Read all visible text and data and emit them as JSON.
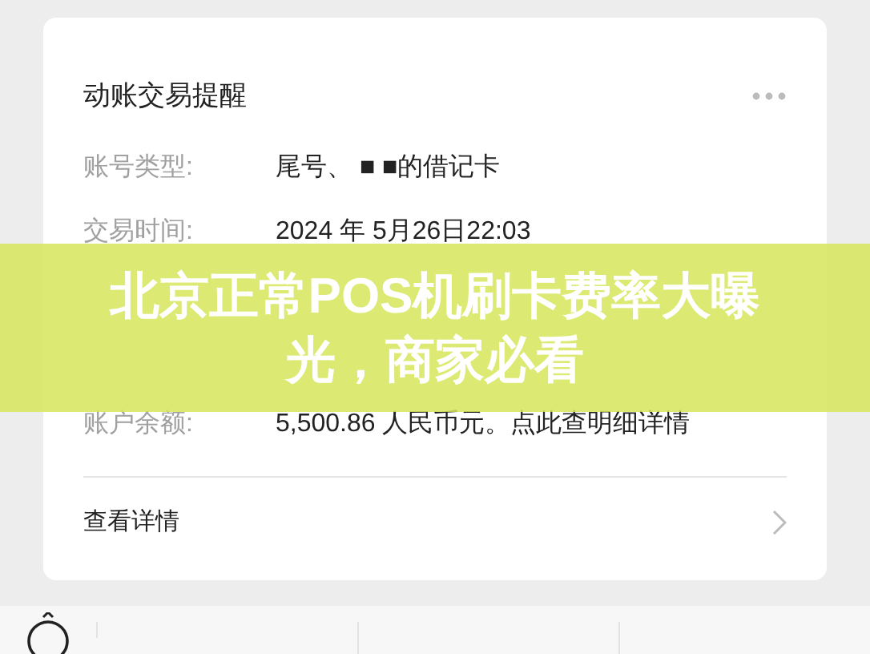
{
  "card": {
    "title": "动账交易提醒",
    "rows": [
      {
        "label": "账号类型:",
        "value": "尾号、 ■ ■的借记卡"
      },
      {
        "label": "交易时间:",
        "value": "2024 年 5月26日22:03"
      },
      {
        "label": "账户余额:",
        "value": "5,500.86 人民币元。点此查明细详情"
      }
    ],
    "link": "查看详情"
  },
  "banner": {
    "headline": "北京正常POS机刷卡费率大曝光，商家必看"
  }
}
